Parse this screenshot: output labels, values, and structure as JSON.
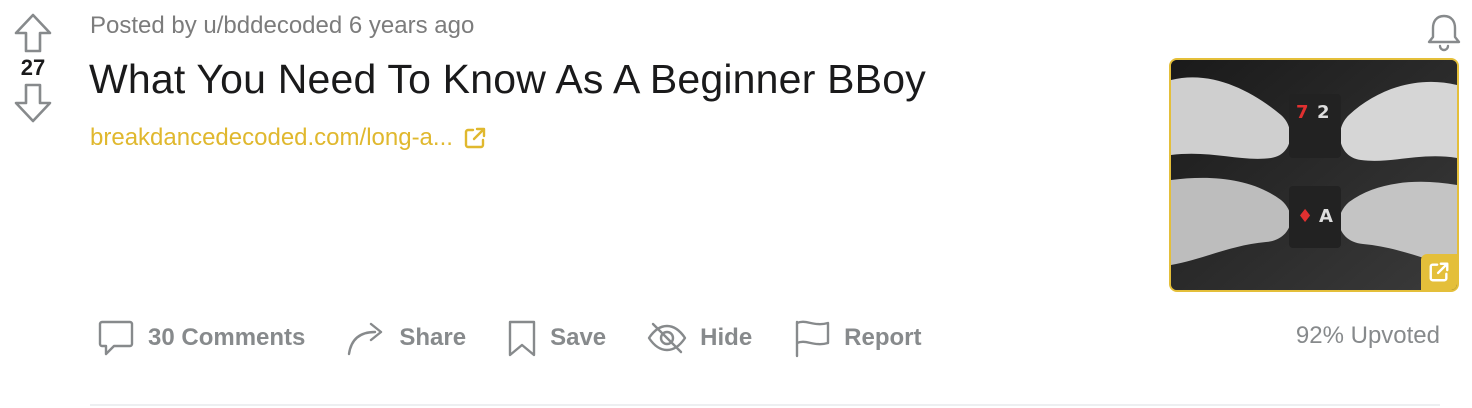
{
  "post": {
    "vote_count": "27",
    "meta_prefix": "Posted by",
    "author": "u/bddecoded",
    "time_ago": "6 years ago",
    "title": "What You Need To Know As A Beginner BBoy",
    "link_display": "breakdancedecoded.com/long-a...",
    "thumbnail_icon": "external-link-icon"
  },
  "actions": {
    "comments_label": "30 Comments",
    "share_label": "Share",
    "save_label": "Save",
    "hide_label": "Hide",
    "report_label": "Report"
  },
  "stats": {
    "upvoted": "92% Upvoted"
  },
  "colors": {
    "accent": "#e4bf3a",
    "link": "#e0b82e",
    "icon_gray": "#878a8c",
    "text_dark": "#1a1a1b"
  }
}
